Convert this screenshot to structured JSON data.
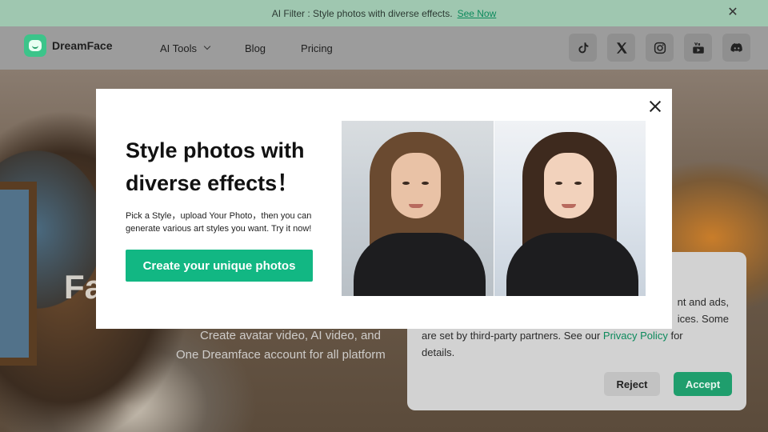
{
  "announcement": {
    "text": "AI Filter : Style photos with diverse effects.",
    "link": "See Now",
    "close_icon": "close-icon"
  },
  "header": {
    "logo_text": "DreamFace",
    "nav": {
      "ai_tools": "AI Tools",
      "blog": "Blog",
      "pricing": "Pricing"
    },
    "socials": [
      "tiktok-icon",
      "x-icon",
      "instagram-icon",
      "youtube-icon",
      "discord-icon"
    ]
  },
  "hero": {
    "title": "Fa",
    "subtitle_1": "Create avatar video, AI video, and",
    "subtitle_2": "One Dreamface account for all platform"
  },
  "cookie": {
    "text_1": "nt and ads,",
    "text_2": "ices. Some",
    "text_3": "are set by third-party partners. See our",
    "privacy_link": "Privacy Policy",
    "text_4": "for",
    "text_5": "details.",
    "reject": "Reject",
    "accept": "Accept"
  },
  "modal": {
    "title": "Style photos with diverse effects！",
    "description": "Pick a Style，upload Your Photo，then you can generate various art styles you want. Try it now!",
    "cta": "Create your unique photos"
  },
  "colors": {
    "accent": "#12b783",
    "announce_bg": "#9fc7b0",
    "link": "#0c8a5c"
  }
}
